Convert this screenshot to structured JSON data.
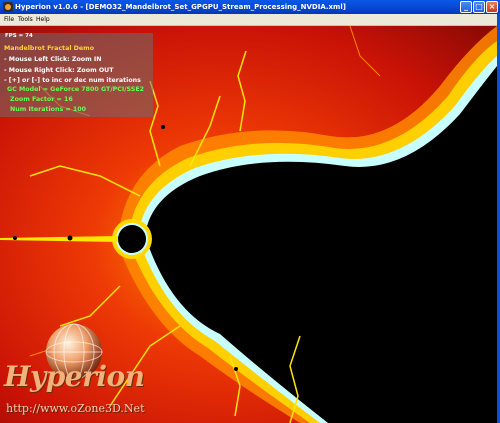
{
  "window": {
    "title": "Hyperion v1.0.6 - [DEMO32_Mandelbrot_Set_GPGPU_Stream_Processing_NVDIA.xml]",
    "controls": {
      "minimize": "_",
      "maximize": "□",
      "close": "×"
    }
  },
  "menu": {
    "file": "File",
    "tools": "Tools",
    "help": "Help"
  },
  "overlay": {
    "fps": "FPS = 74",
    "title": "Mandelbrot Fractal Demo",
    "lines": [
      "- Mouse Left Click: Zoom IN",
      "- Mouse Right Click: Zoom OUT",
      "- [+] or [-] to inc or dec num iterations"
    ],
    "gc_model": "GC Model = GeForce 7800 GT/PCI/SSE2",
    "zoom_factor": "Zoom Factor = 16",
    "num_iterations": "Num Iterations = 100"
  },
  "logo": {
    "text": "Hyperion",
    "url": "http://www.oZone3D.Net"
  },
  "colors": {
    "fractal_red": "#e51a08",
    "fractal_orange": "#ff8a00",
    "fractal_yellow": "#ffe600",
    "edge_cyan": "#c8ffff",
    "set_black": "#000000"
  }
}
